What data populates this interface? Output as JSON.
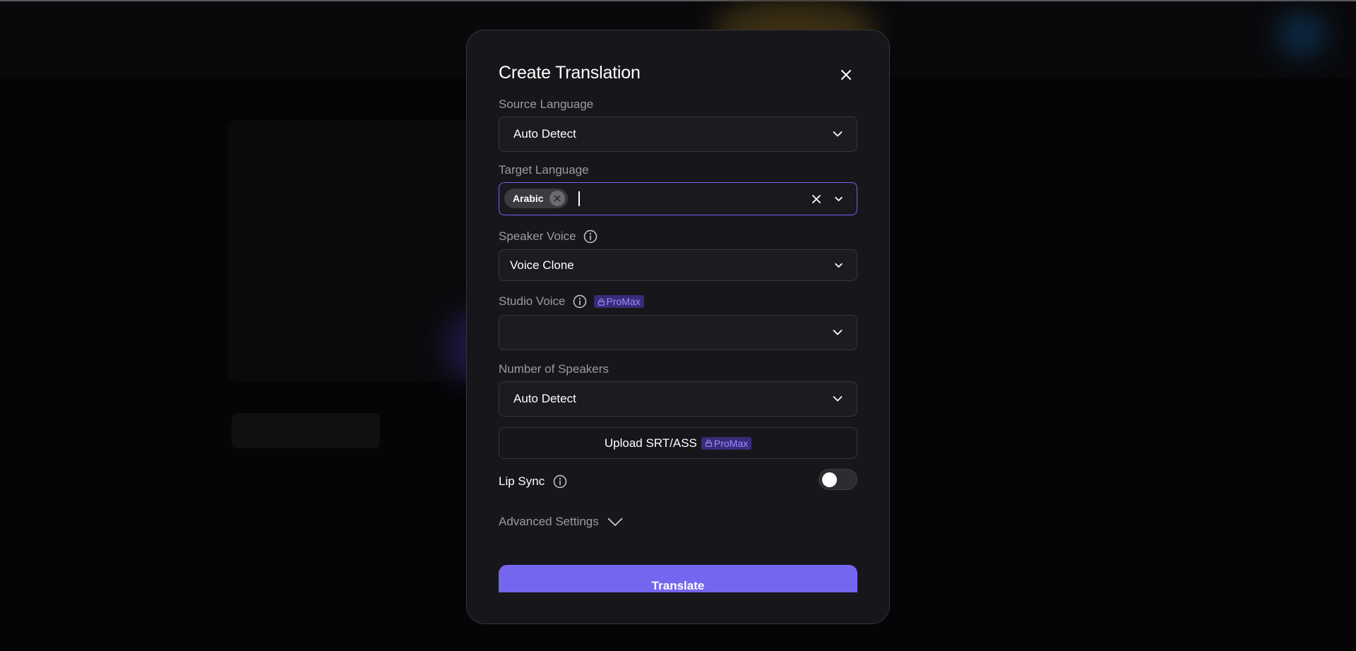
{
  "modal": {
    "title": "Create Translation"
  },
  "source_language": {
    "label": "Source Language",
    "value": "Auto Detect"
  },
  "target_language": {
    "label": "Target Language",
    "selected": [
      "Arabic"
    ]
  },
  "speaker_voice": {
    "label": "Speaker Voice",
    "value": "Voice Clone"
  },
  "studio_voice": {
    "label": "Studio Voice",
    "badge": "ProMax",
    "value": ""
  },
  "number_of_speakers": {
    "label": "Number of Speakers",
    "value": "Auto Detect"
  },
  "upload": {
    "label": "Upload SRT/ASS",
    "badge": "ProMax"
  },
  "lip_sync": {
    "label": "Lip Sync",
    "enabled": false
  },
  "advanced": {
    "label": "Advanced Settings"
  },
  "translate_button": {
    "label": "Translate"
  },
  "colors": {
    "accent": "#7566f0",
    "badge_bg": "#3a2b7a",
    "badge_text": "#9d8cff",
    "modal_bg": "#17171b"
  },
  "icons": {
    "close": "close-icon",
    "chevron": "chevron-down-icon",
    "info": "info-icon",
    "lock": "lock-icon"
  }
}
